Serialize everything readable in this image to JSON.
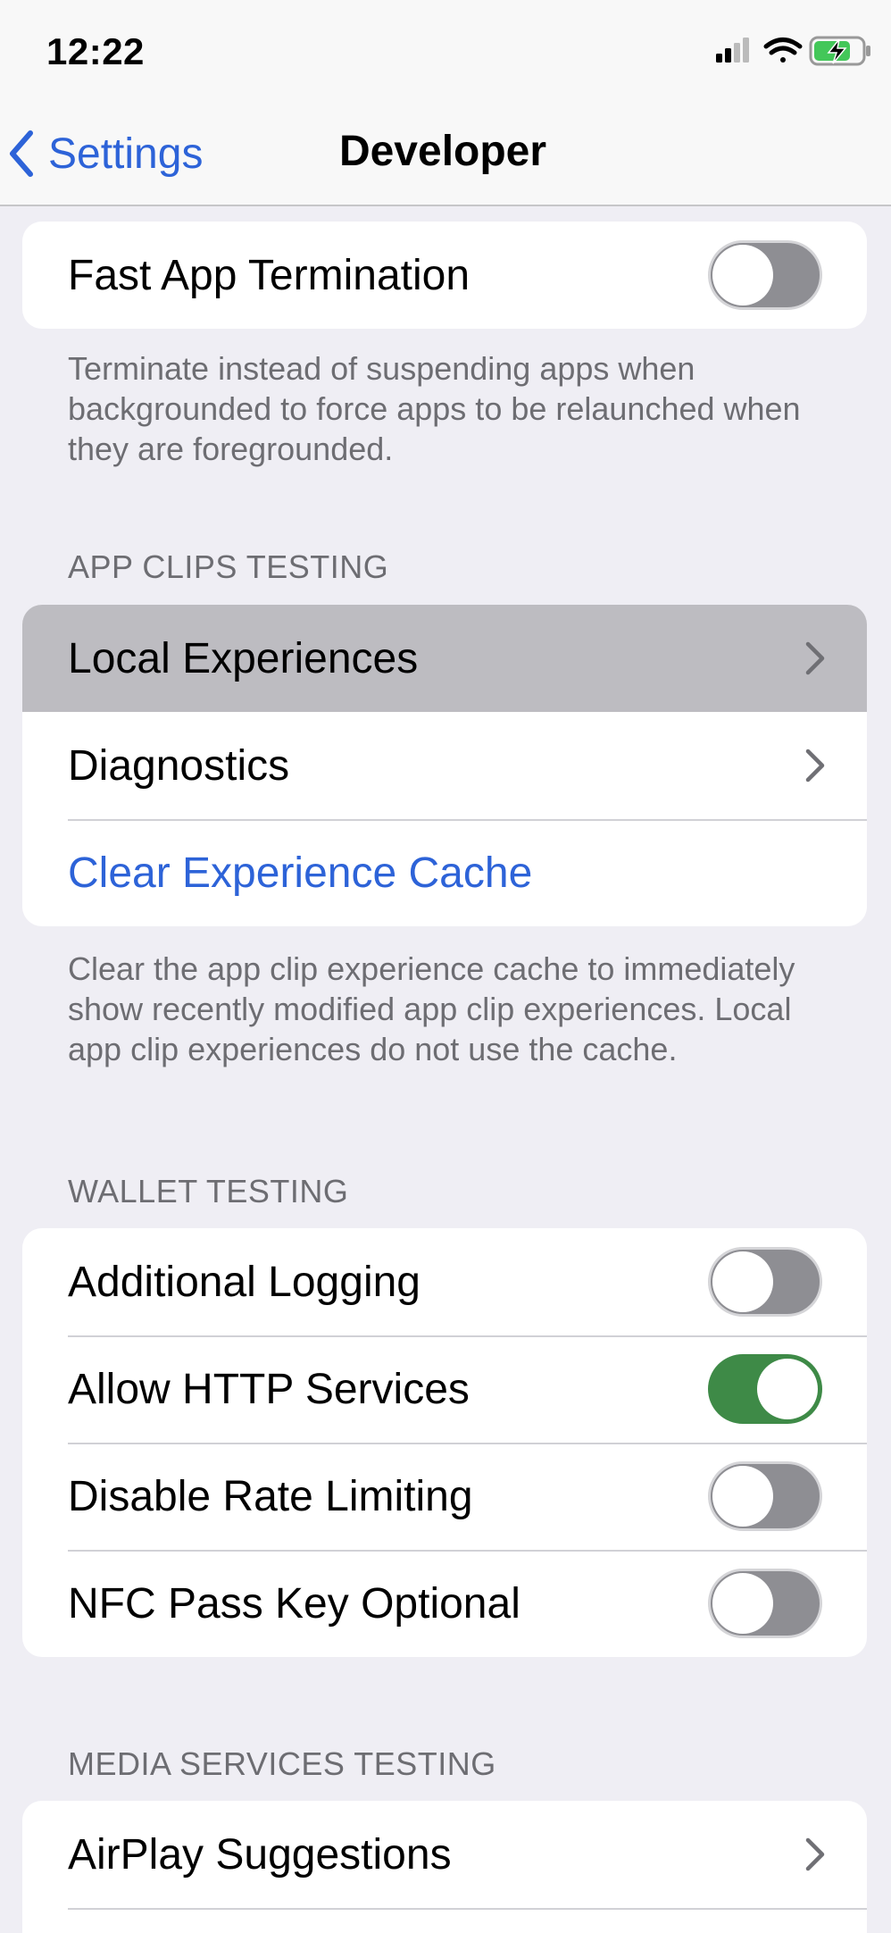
{
  "status_bar": {
    "time": "12:22"
  },
  "nav": {
    "back_label": "Settings",
    "title": "Developer"
  },
  "fast_app": {
    "label": "Fast App Termination",
    "enabled": false,
    "footer": "Terminate instead of suspending apps when backgrounded to force apps to be relaunched when they are foregrounded."
  },
  "app_clips": {
    "header": "APP CLIPS TESTING",
    "rows": [
      "Local Experiences",
      "Diagnostics"
    ],
    "clear_label": "Clear Experience Cache",
    "footer": "Clear the app clip experience cache to immediately show recently modified app clip experiences. Local app clip experiences do not use the cache."
  },
  "wallet": {
    "header": "WALLET TESTING",
    "rows": [
      {
        "label": "Additional Logging",
        "enabled": false
      },
      {
        "label": "Allow HTTP Services",
        "enabled": true
      },
      {
        "label": "Disable Rate Limiting",
        "enabled": false
      },
      {
        "label": "NFC Pass Key Optional",
        "enabled": false
      }
    ]
  },
  "media": {
    "header": "MEDIA SERVICES TESTING",
    "rows": [
      "AirPlay Suggestions"
    ]
  },
  "colors": {
    "accent": "#2d63d8",
    "toggle_on": "#3e8a47",
    "toggle_off": "#8e8e93",
    "background": "#efeef4"
  }
}
